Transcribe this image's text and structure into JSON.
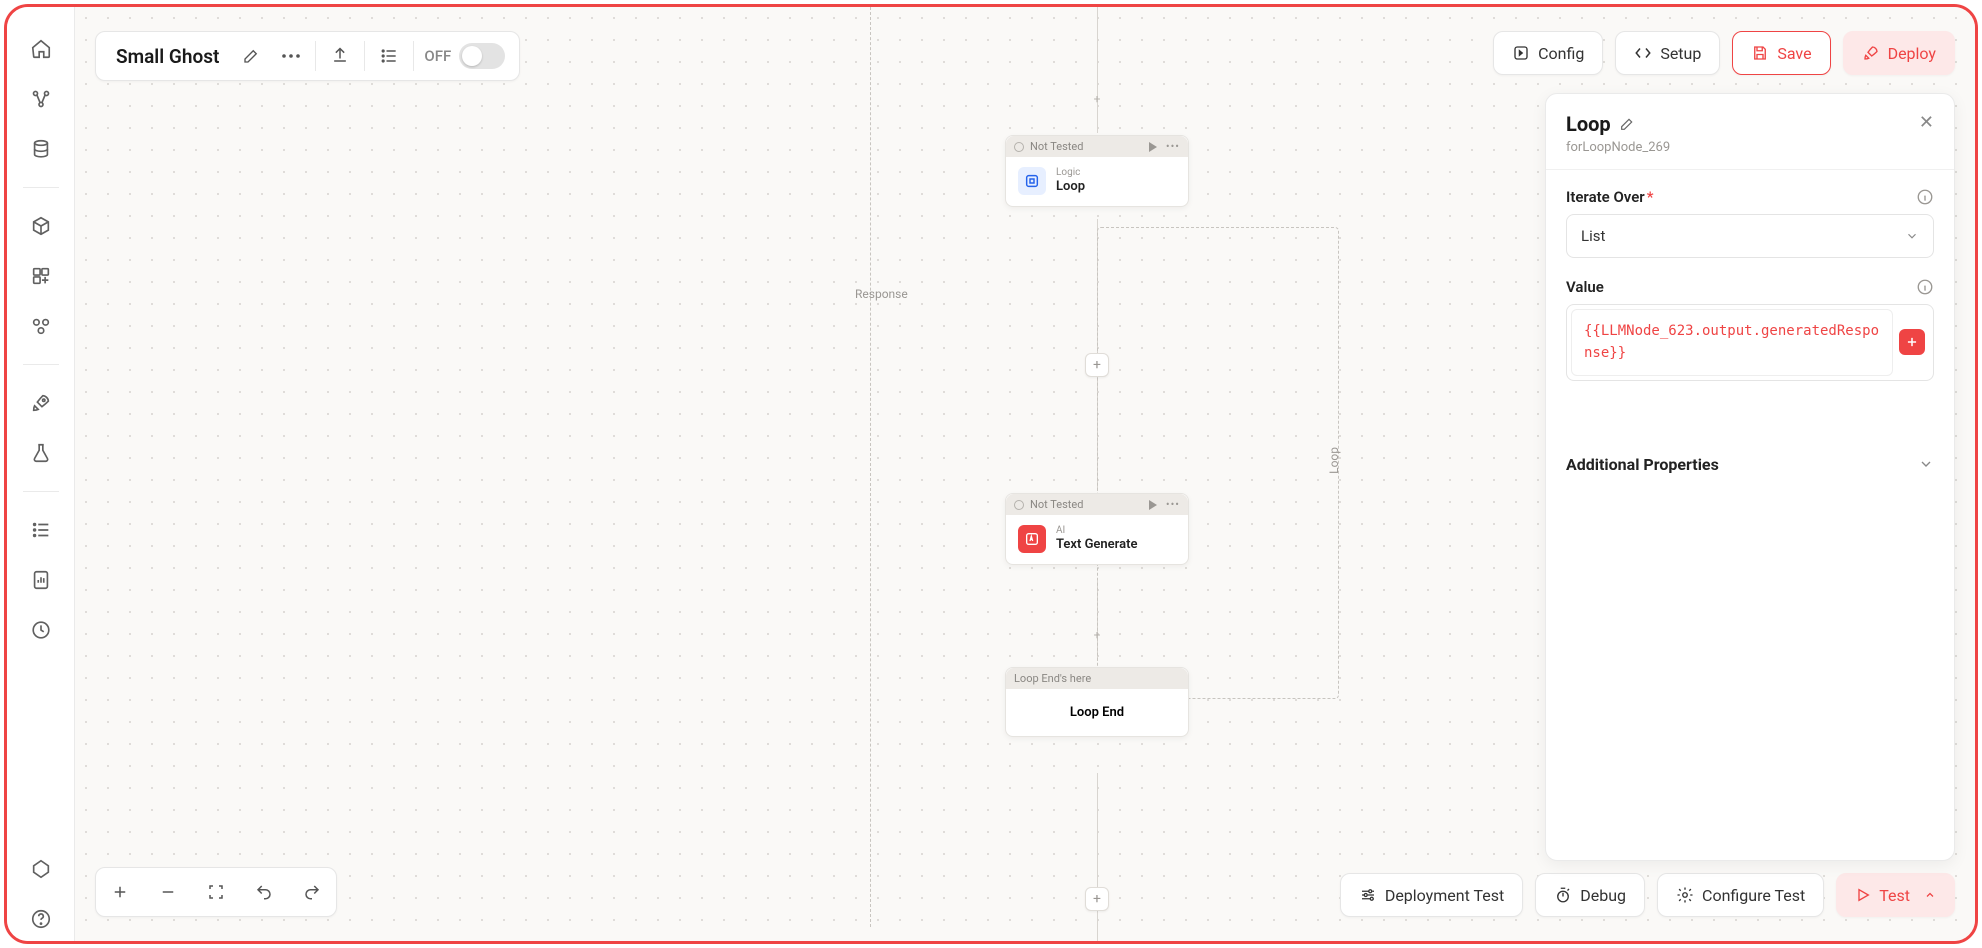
{
  "header": {
    "title": "Small Ghost",
    "toggle_label": "OFF"
  },
  "top_buttons": {
    "config": "Config",
    "setup": "Setup",
    "save": "Save",
    "deploy": "Deploy"
  },
  "bottom_buttons": {
    "deployment_test": "Deployment Test",
    "debug": "Debug",
    "configure_test": "Configure Test",
    "test": "Test"
  },
  "canvas": {
    "response_label": "Response",
    "loop_label": "Loop",
    "nodes": {
      "loop": {
        "status": "Not Tested",
        "category": "Logic",
        "name": "Loop"
      },
      "textgen": {
        "status": "Not Tested",
        "category": "AI",
        "name": "Text Generate"
      },
      "loopend": {
        "header": "Loop End's here",
        "name": "Loop End"
      }
    }
  },
  "panel": {
    "title": "Loop",
    "subtitle": "forLoopNode_269",
    "iterate_label": "Iterate Over",
    "iterate_value": "List",
    "value_label": "Value",
    "value_expr": "{{LLMNode_623.output.generatedResponse}}",
    "additional": "Additional Properties"
  }
}
